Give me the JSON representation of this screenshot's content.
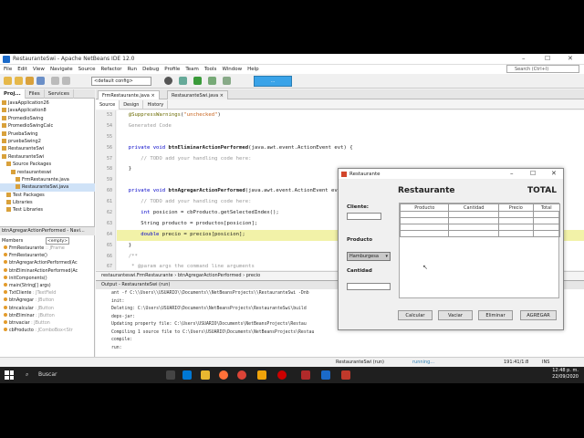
{
  "window": {
    "title": "RestauranteSwi - Apache NetBeans IDE 12.0",
    "controls": [
      "–",
      "☐",
      "✕"
    ]
  },
  "menu": [
    "File",
    "Edit",
    "View",
    "Navigate",
    "Source",
    "Refactor",
    "Run",
    "Debug",
    "Profile",
    "Team",
    "Tools",
    "Window",
    "Help"
  ],
  "search": {
    "placeholder": "Search (Ctrl+I)"
  },
  "toolbar": {
    "config": "<default config>",
    "memory": "..."
  },
  "projects": {
    "tabs": [
      "Proj...",
      "Files",
      "Services"
    ],
    "items": [
      {
        "label": "JavaApplication26",
        "indent": 0
      },
      {
        "label": "JavaApplication8",
        "indent": 0
      },
      {
        "label": "PromedioSwing",
        "indent": 0
      },
      {
        "label": "PromedioSwingCalc",
        "indent": 0
      },
      {
        "label": "PruebaSwing",
        "indent": 0
      },
      {
        "label": "pruebaSwing2",
        "indent": 0
      },
      {
        "label": "RestauranteSwi",
        "indent": 0
      },
      {
        "label": "RestauranteSwi",
        "indent": 0
      },
      {
        "label": "Source Packages",
        "indent": 1
      },
      {
        "label": "restauranteswi",
        "indent": 2
      },
      {
        "label": "FrmRestaurante.java",
        "indent": 3
      },
      {
        "label": "RestauranteSwi.java",
        "indent": 3,
        "selected": true
      },
      {
        "label": "Test Packages",
        "indent": 1
      },
      {
        "label": "Libraries",
        "indent": 1
      },
      {
        "label": "Test Libraries",
        "indent": 1
      }
    ]
  },
  "navigator": {
    "title": "btnAgregarActionPerformed - Navi...",
    "members_label": "Members",
    "filter": "<empty>",
    "items": [
      {
        "name": "FrmRestaurante",
        "type": " :: JFrame"
      },
      {
        "name": "FrmRestaurante()",
        "type": ""
      },
      {
        "name": "btnAgregarActionPerformed(Ac",
        "type": ""
      },
      {
        "name": "btnEliminarActionPerformed(Ac",
        "type": ""
      },
      {
        "name": "initComponents()",
        "type": ""
      },
      {
        "name": "main(String[] args)",
        "type": ""
      },
      {
        "name": "TxtCliente",
        "type": " : JTextField"
      },
      {
        "name": "btnAgregar",
        "type": " : JButton"
      },
      {
        "name": "btncalcular",
        "type": " : JButton"
      },
      {
        "name": "btnEliminar",
        "type": " : JButton"
      },
      {
        "name": "btnvaciar",
        "type": " : JButton"
      },
      {
        "name": "cbProducto",
        "type": " : JComboBox<Str"
      }
    ]
  },
  "editor": {
    "tabs": [
      "FrmRestaurante.java",
      "RestauranteSwi.java"
    ],
    "subtabs": [
      "Source",
      "Design",
      "History"
    ],
    "line_numbers": [
      "53",
      "54",
      "55",
      "56",
      "57",
      "58",
      "59",
      "60",
      "61",
      "62",
      "63",
      "64",
      "65",
      "66",
      "67"
    ],
    "breadcrumb": [
      "restauranteswi.FrmRestaurante",
      "btnAgregarActionPerformed",
      "precio"
    ]
  },
  "output": {
    "title": "Output - RestauranteSwi (run)",
    "lines": [
      "ant -f C:\\\\Users\\\\USUARIO\\\\Documents\\\\NetBeansProjects\\\\RestauranteSwi -Dnb",
      "init:",
      "Deleting: C:\\Users\\USUARIO\\Documents\\NetBeansProjects\\RestauranteSwi\\build",
      "deps-jar:",
      "Updating property file: C:\\Users\\USUARIO\\Documents\\NetBeansProjects\\Restau",
      "Compiling 1 source file to C:\\Users\\USUARIO\\Documents\\NetBeansProjects\\Restau",
      "compile:",
      "run:"
    ]
  },
  "status": {
    "task": "RestauranteSwi (run)",
    "state": "running...",
    "position": "191:41/1:8",
    "mode": "INS"
  },
  "dialog": {
    "title": "Restaurante",
    "heading": "Restaurante",
    "total_label": "TOTAL",
    "cliente_label": "Cliente:",
    "producto_label": "Producto",
    "producto_value": "Hamburgesa",
    "cantidad_label": "Cantidad",
    "table_headers": [
      "Producto",
      "Cantidad",
      "Precio",
      "Total"
    ],
    "buttons": [
      "Calcular",
      "Vaciar",
      "Eliminar",
      "AGREGAR"
    ]
  },
  "taskbar": {
    "search": "Buscar",
    "time": "12:48 p. m.",
    "date": "22/09/2020"
  }
}
